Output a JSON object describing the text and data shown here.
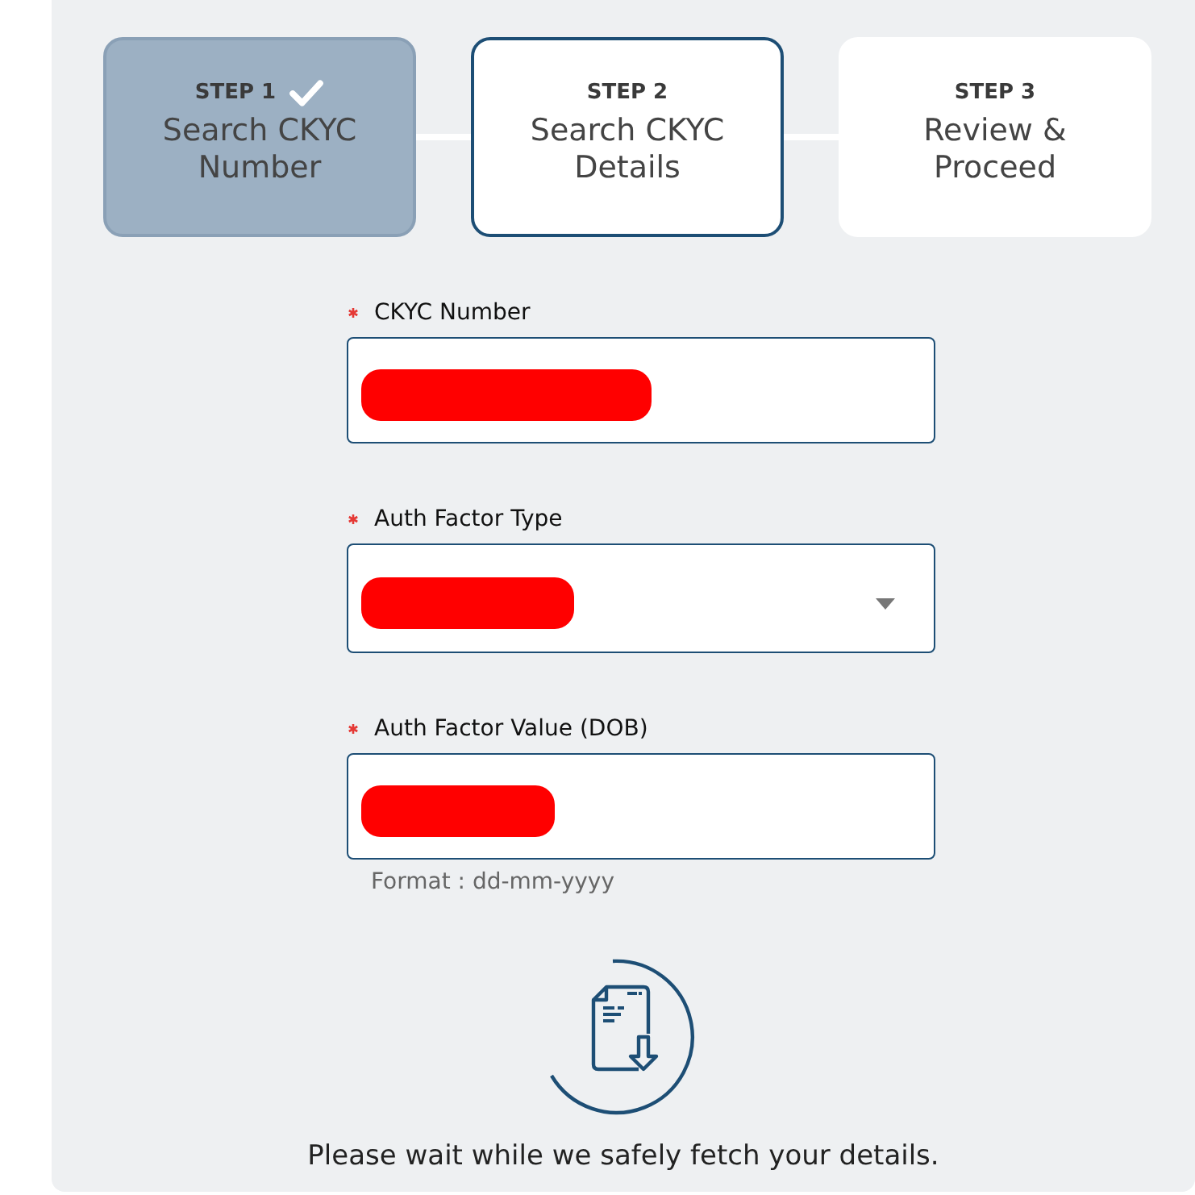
{
  "steps": [
    {
      "label": "STEP 1",
      "title": "Search CKYC Number",
      "completed": true,
      "selected": false
    },
    {
      "label": "STEP 2",
      "title": "Search CKYC Details",
      "completed": false,
      "selected": true
    },
    {
      "label": "STEP 3",
      "title": "Review & Proceed",
      "completed": false,
      "selected": false
    }
  ],
  "fields": [
    {
      "label": "CKYC Number",
      "required": true,
      "kind": "text"
    },
    {
      "label": "Auth Factor Type",
      "required": true,
      "kind": "select"
    },
    {
      "label": "Auth Factor Value (DOB)",
      "required": true,
      "kind": "text",
      "hint": "Format : dd-mm-yyyy"
    }
  ],
  "loading_message": "Please wait while we safely fetch your details."
}
